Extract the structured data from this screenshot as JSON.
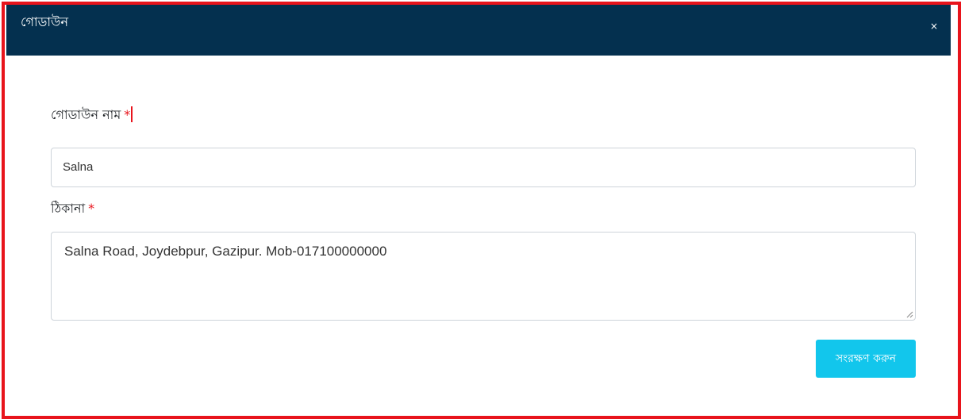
{
  "modal": {
    "title": "গোডাউন",
    "close_label": "×"
  },
  "form": {
    "name_label": "গোডাউন নাম",
    "name_value": "Salna",
    "address_label": "ঠিকানা",
    "address_value": "Salna Road, Joydebpur, Gazipur. Mob-017100000000",
    "required_mark": "*",
    "save_label": "সংরক্ষণ করুন"
  },
  "colors": {
    "header_bg": "#04304f",
    "frame_border": "#e8141c",
    "save_button": "#12c6ec",
    "required": "#e8141c"
  }
}
